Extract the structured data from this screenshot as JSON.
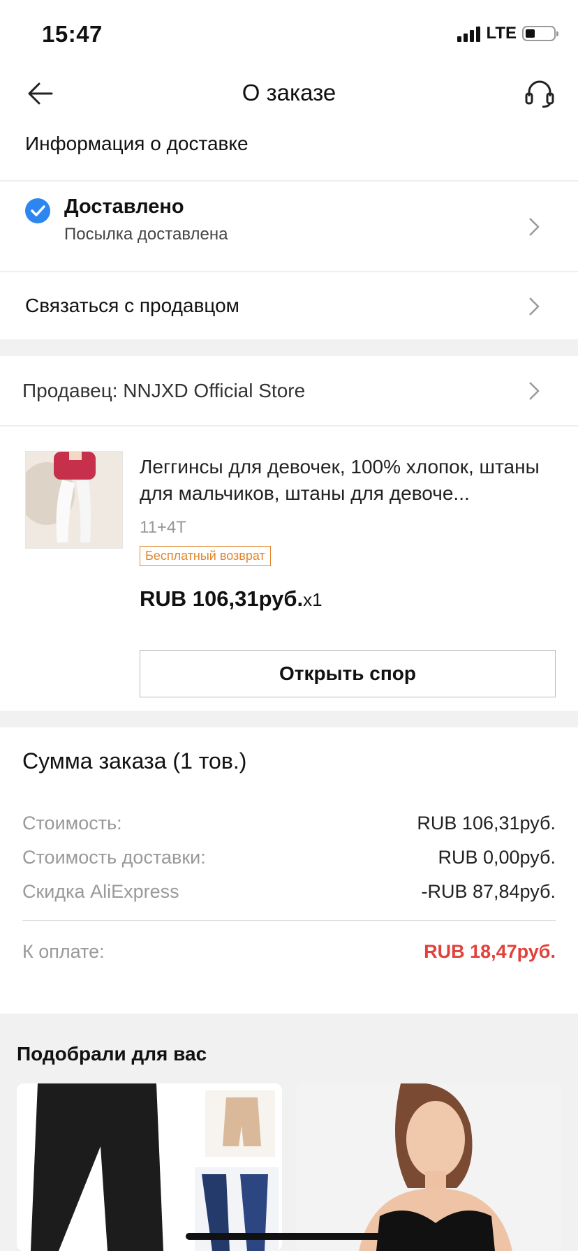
{
  "status_bar": {
    "time": "15:47",
    "network": "LTE"
  },
  "nav": {
    "title": "О заказе"
  },
  "delivery": {
    "section_title": "Информация о доставке",
    "status_title": "Доставлено",
    "status_subtitle": "Посылка доставлена",
    "contact_seller": "Связаться с продавцом"
  },
  "seller": {
    "label": "Продавец: NNJXD Official Store"
  },
  "product": {
    "name": "Леггинсы для девочек, 100% хлопок, штаны для мальчиков, штаны для девоче...",
    "variant": "11+4T",
    "badge": "Бесплатный возврат",
    "price": "RUB 106,31руб.",
    "quantity": "x1",
    "dispute_button": "Открыть спор"
  },
  "summary": {
    "title": "Сумма заказа (1 тов.)",
    "lines": [
      {
        "label": "Стоимость:",
        "value": "RUB 106,31руб."
      },
      {
        "label": "Стоимость доставки:",
        "value": "RUB 0,00руб."
      },
      {
        "label": "Скидка AliExpress",
        "value": "-RUB 87,84руб."
      }
    ],
    "total_label": "К оплате:",
    "total_value": "RUB 18,47руб."
  },
  "recommendations": {
    "title": "Подобрали для вас"
  },
  "colors": {
    "accent_blue": "#2d86f0",
    "price_red": "#e2413b",
    "badge_orange": "#e4852b"
  }
}
